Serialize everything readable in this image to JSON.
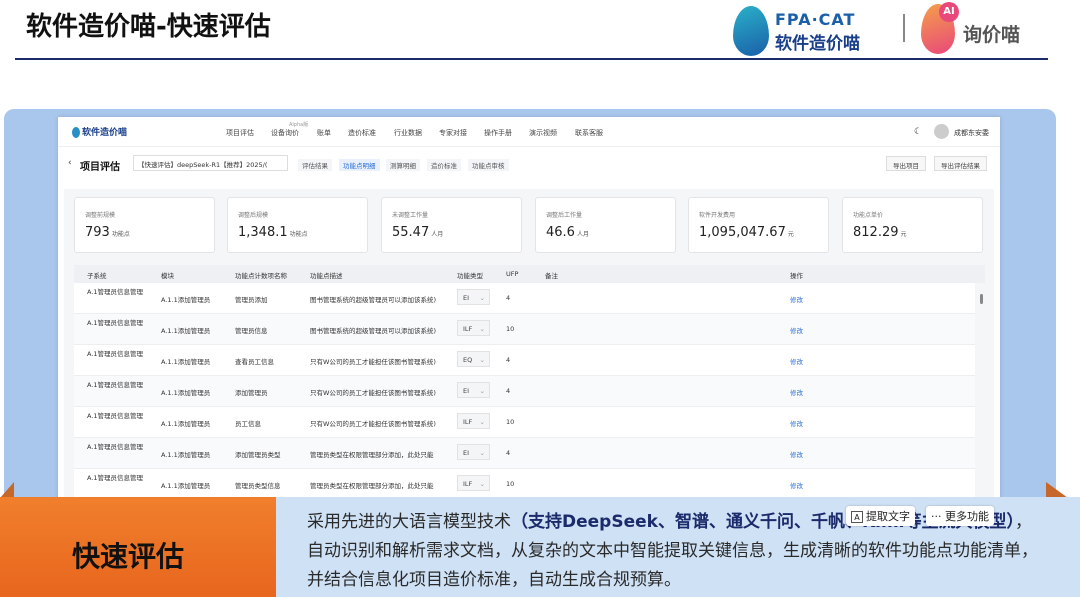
{
  "slide": {
    "title": "软件造价喵-快速评估",
    "brand_left_top": "FPA·CAT",
    "brand_left_bottom": "软件造价喵",
    "brand_right_badge": "AI",
    "brand_right_name": "询价喵"
  },
  "app": {
    "logo": "软件造价喵",
    "nav": [
      "项目评估",
      "设备询价",
      "账单",
      "造价标准",
      "行业数据",
      "专家对接",
      "操作手册",
      "演示视频",
      "联系客服"
    ],
    "nav_small": "Alpha版",
    "user_name": "成都东安委",
    "page_title": "项目评估",
    "project_select": "【快速评估】deepSeek-R1【推荐】2025/(",
    "tabs": [
      "评估结果",
      "功能点明细",
      "测算明细",
      "造价标准",
      "功能点审核"
    ],
    "active_tab": "功能点明细",
    "buttons": [
      "导出项目",
      "导出评估结果"
    ]
  },
  "summary_cards": [
    {
      "label": "调整前规模",
      "value": "793",
      "unit": "功能点"
    },
    {
      "label": "调整后规模",
      "value": "1,348.1",
      "unit": "功能点"
    },
    {
      "label": "未调整工作量",
      "value": "55.47",
      "unit": "人月"
    },
    {
      "label": "调整后工作量",
      "value": "46.6",
      "unit": "人月"
    },
    {
      "label": "软件开发费用",
      "value": "1,095,047.67",
      "unit": "元"
    },
    {
      "label": "功能点单价",
      "value": "812.29",
      "unit": "元"
    }
  ],
  "table": {
    "headers": [
      "子系统",
      "模块",
      "功能点计数项名称",
      "功能点描述",
      "功能类型",
      "UFP",
      "备注",
      "操作"
    ],
    "rows": [
      {
        "sub": "A.1管理员信息管理",
        "mod": "A.1.1添加管理员",
        "fn": "管理员添加",
        "desc": "图书管理系统的超级管理员可以添加该系统)",
        "type": "EI",
        "ufp": "4",
        "op": "修改"
      },
      {
        "sub": "A.1管理员信息管理",
        "mod": "A.1.1添加管理员",
        "fn": "管理员信息",
        "desc": "图书管理系统的超级管理员可以添加该系统)",
        "type": "ILF",
        "ufp": "10",
        "op": "修改"
      },
      {
        "sub": "A.1管理员信息管理",
        "mod": "A.1.1添加管理员",
        "fn": "查看员工信息",
        "desc": "只有W公司的员工才能担任该图书管理系统)",
        "type": "EQ",
        "ufp": "4",
        "op": "修改"
      },
      {
        "sub": "A.1管理员信息管理",
        "mod": "A.1.1添加管理员",
        "fn": "添加管理员",
        "desc": "只有W公司的员工才能担任该图书管理系统)",
        "type": "EI",
        "ufp": "4",
        "op": "修改"
      },
      {
        "sub": "A.1管理员信息管理",
        "mod": "A.1.1添加管理员",
        "fn": "员工信息",
        "desc": "只有W公司的员工才能担任该图书管理系统)",
        "type": "ILF",
        "ufp": "10",
        "op": "修改"
      },
      {
        "sub": "A.1管理员信息管理",
        "mod": "A.1.1添加管理员",
        "fn": "添加管理员类型",
        "desc": "管理员类型在权限管理部分添加，此处只能",
        "type": "EI",
        "ufp": "4",
        "op": "修改"
      },
      {
        "sub": "A.1管理员信息管理",
        "mod": "A.1.1添加管理员",
        "fn": "管理员类型信息",
        "desc": "管理员类型在权限管理部分添加，此处只能",
        "type": "ILF",
        "ufp": "10",
        "op": "修改"
      }
    ]
  },
  "bottom": {
    "title": "快速评估",
    "text_pre": "采用先进的大语言模型技术",
    "text_bold": "（支持DeepSeek、智谱、通义千问、千帆、Kimi等主流大模型）",
    "text_post": "，自动识别和解析需求文档，从复杂的文本中智能提取关键信息，生成清晰的软件功能点功能清单，并结合信息化项目造价标准，自动生成合规预算。"
  },
  "context_bar": {
    "extract_icon": "A",
    "extract": "提取文字",
    "more_icon": "···",
    "more": "更多功能"
  }
}
